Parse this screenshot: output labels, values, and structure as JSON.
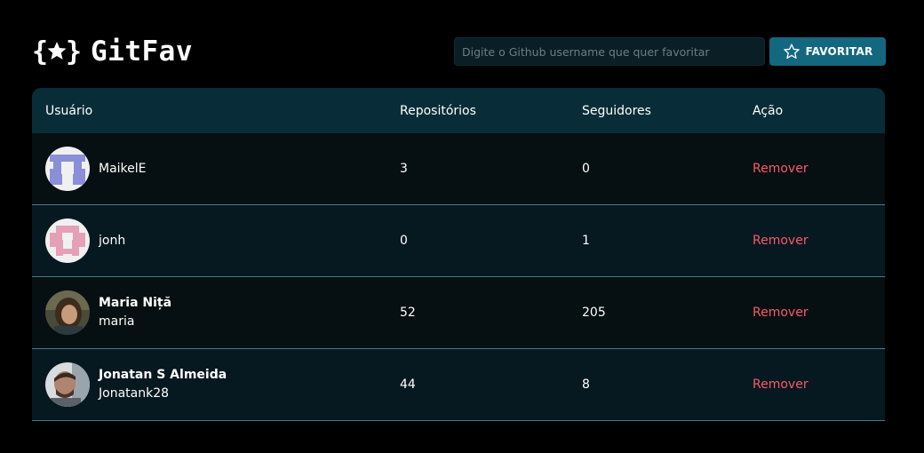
{
  "app": {
    "title": "GitFav"
  },
  "search": {
    "placeholder": "Digite o Github username que quer favoritar",
    "button_label": "FAVORITAR"
  },
  "table": {
    "headers": {
      "user": "Usuário",
      "repos": "Repositórios",
      "followers": "Seguidores",
      "action": "Ação"
    },
    "rows": [
      {
        "name": "",
        "login": "MaikelE",
        "repos": "3",
        "followers": "0",
        "action": "Remover",
        "avatar": "identicon-blue"
      },
      {
        "name": "",
        "login": "jonh",
        "repos": "0",
        "followers": "1",
        "action": "Remover",
        "avatar": "identicon-pink"
      },
      {
        "name": "Maria Niță",
        "login": "maria",
        "repos": "52",
        "followers": "205",
        "action": "Remover",
        "avatar": "photo-woman"
      },
      {
        "name": "Jonatan S Almeida",
        "login": "Jonatank28",
        "repos": "44",
        "followers": "8",
        "action": "Remover",
        "avatar": "photo-man"
      }
    ]
  },
  "colors": {
    "background": "#000000",
    "header_row": "#092d38",
    "button": "#136880",
    "remove": "#f75a68",
    "row_border": "#4a7a84"
  }
}
